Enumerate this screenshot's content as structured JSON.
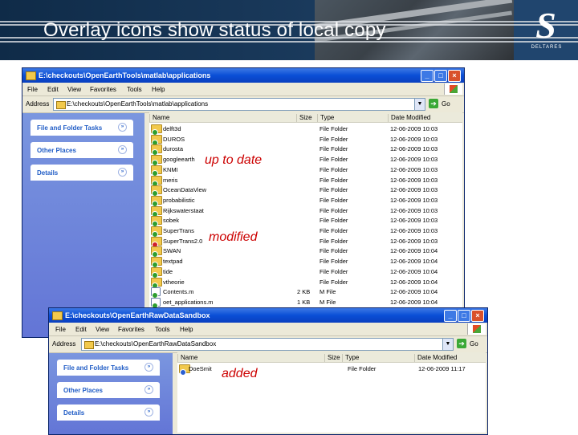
{
  "slide": {
    "title": "Overlay icons show status of local copy",
    "logo_text": "DELTARES"
  },
  "annotations": {
    "up_to_date": "up to date",
    "modified": "modified",
    "added": "added"
  },
  "window1": {
    "title": "E:\\checkouts\\OpenEarthTools\\matlab\\applications",
    "menu": [
      "File",
      "Edit",
      "View",
      "Favorites",
      "Tools",
      "Help"
    ],
    "address_label": "Address",
    "address_value": "E:\\checkouts\\OpenEarthTools\\matlab\\applications",
    "go_label": "Go",
    "tasks": [
      "File and Folder Tasks",
      "Other Places",
      "Details"
    ],
    "columns": [
      "Name",
      "Size",
      "Type",
      "Date Modified"
    ],
    "rows": [
      {
        "name": "delft3d",
        "size": "",
        "type": "File Folder",
        "date": "12-06-2009 10:03",
        "kind": "folder",
        "status": "ok"
      },
      {
        "name": "DUROS",
        "size": "",
        "type": "File Folder",
        "date": "12-06-2009 10:03",
        "kind": "folder",
        "status": "ok"
      },
      {
        "name": "durosta",
        "size": "",
        "type": "File Folder",
        "date": "12-06-2009 10:03",
        "kind": "folder",
        "status": "ok"
      },
      {
        "name": "googleearth",
        "size": "",
        "type": "File Folder",
        "date": "12-06-2009 10:03",
        "kind": "folder",
        "status": "ok"
      },
      {
        "name": "KNMI",
        "size": "",
        "type": "File Folder",
        "date": "12-06-2009 10:03",
        "kind": "folder",
        "status": "ok"
      },
      {
        "name": "meris",
        "size": "",
        "type": "File Folder",
        "date": "12-06-2009 10:03",
        "kind": "folder",
        "status": "ok"
      },
      {
        "name": "OceanDataView",
        "size": "",
        "type": "File Folder",
        "date": "12-06-2009 10:03",
        "kind": "folder",
        "status": "ok"
      },
      {
        "name": "probabilistic",
        "size": "",
        "type": "File Folder",
        "date": "12-06-2009 10:03",
        "kind": "folder",
        "status": "ok"
      },
      {
        "name": "Rijkswaterstaat",
        "size": "",
        "type": "File Folder",
        "date": "12-06-2009 10:03",
        "kind": "folder",
        "status": "ok"
      },
      {
        "name": "sobek",
        "size": "",
        "type": "File Folder",
        "date": "12-06-2009 10:03",
        "kind": "folder",
        "status": "ok"
      },
      {
        "name": "SuperTrans",
        "size": "",
        "type": "File Folder",
        "date": "12-06-2009 10:03",
        "kind": "folder",
        "status": "ok"
      },
      {
        "name": "SuperTrans2.0",
        "size": "",
        "type": "File Folder",
        "date": "12-06-2009 10:03",
        "kind": "folder",
        "status": "mod"
      },
      {
        "name": "SWAN",
        "size": "",
        "type": "File Folder",
        "date": "12-06-2009 10:04",
        "kind": "folder",
        "status": "ok"
      },
      {
        "name": "textpad",
        "size": "",
        "type": "File Folder",
        "date": "12-06-2009 10:04",
        "kind": "folder",
        "status": "ok"
      },
      {
        "name": "tide",
        "size": "",
        "type": "File Folder",
        "date": "12-06-2009 10:04",
        "kind": "folder",
        "status": "ok"
      },
      {
        "name": "vtheorie",
        "size": "",
        "type": "File Folder",
        "date": "12-06-2009 10:04",
        "kind": "folder",
        "status": "ok"
      },
      {
        "name": "Contents.m",
        "size": "2 KB",
        "type": "M File",
        "date": "12-06-2009 10:04",
        "kind": "file",
        "status": "ok"
      },
      {
        "name": "oet_applications.m",
        "size": "1 KB",
        "type": "M File",
        "date": "12-06-2009 10:04",
        "kind": "file",
        "status": "ok"
      }
    ]
  },
  "window2": {
    "title": "E:\\checkouts\\OpenEarthRawDataSandbox",
    "menu": [
      "File",
      "Edit",
      "View",
      "Favorites",
      "Tools",
      "Help"
    ],
    "address_label": "Address",
    "address_value": "E:\\checkouts\\OpenEarthRawDataSandbox",
    "go_label": "Go",
    "tasks": [
      "File and Folder Tasks",
      "Other Places",
      "Details"
    ],
    "columns": [
      "Name",
      "Size",
      "Type",
      "Date Modified"
    ],
    "rows": [
      {
        "name": "DoeSmit",
        "size": "",
        "type": "File Folder",
        "date": "12-06-2009 11:17",
        "kind": "folder",
        "status": "add"
      }
    ]
  },
  "colors": {
    "header_bg": "#1a3a5c",
    "annotation": "#cc0000",
    "status_ok": "#2e9e2e",
    "status_modified": "#d0202a",
    "status_added": "#2a5fd0"
  }
}
